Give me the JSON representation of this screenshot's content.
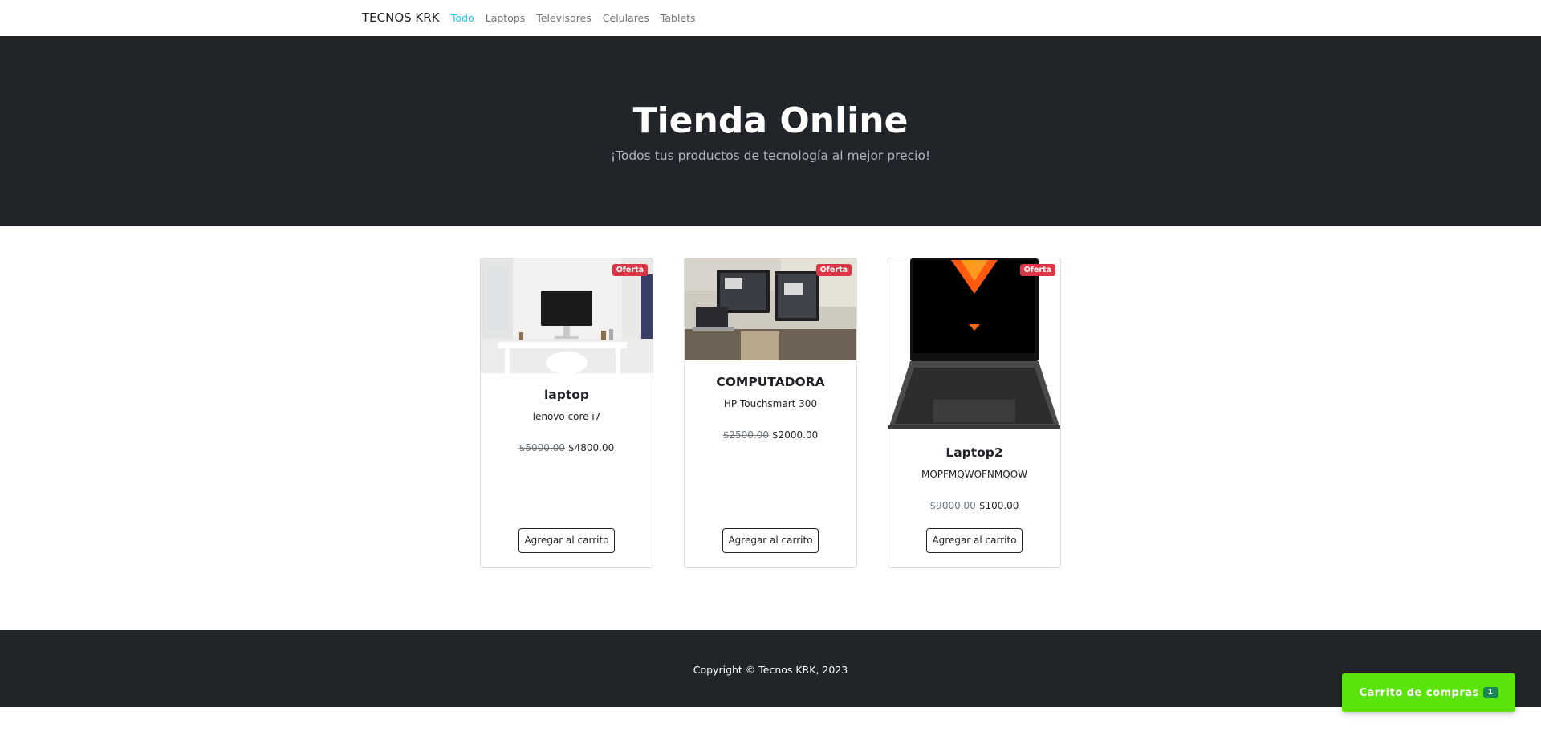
{
  "navbar": {
    "brand": "TECNOS KRK",
    "links": [
      {
        "label": "Todo",
        "active": true
      },
      {
        "label": "Laptops",
        "active": false
      },
      {
        "label": "Televisores",
        "active": false
      },
      {
        "label": "Celulares",
        "active": false
      },
      {
        "label": "Tablets",
        "active": false
      }
    ]
  },
  "hero": {
    "title": "Tienda Online",
    "subtitle": "¡Todos tus productos de tecnología al mejor precio!"
  },
  "products": [
    {
      "badge": "Oferta",
      "name": "laptop",
      "description": "lenovo core i7",
      "old_price": "$5000.00",
      "price": "$4800.00",
      "button": "Agregar al carrito",
      "image": "desk-with-imac-photo"
    },
    {
      "badge": "Oferta",
      "name": "COMPUTADORA",
      "description": "HP Touchsmart 300",
      "old_price": "$2500.00",
      "price": "$2000.00",
      "button": "Agregar al carrito",
      "image": "multi-monitor-desk-photo"
    },
    {
      "badge": "Oferta",
      "name": "Laptop2",
      "description": "MOPFMQWOFNMQOW",
      "old_price": "$9000.00",
      "price": "$100.00",
      "button": "Agregar al carrito",
      "image": "gaming-laptop-photo"
    }
  ],
  "footer": {
    "copyright": "Copyright © Tecnos KRK, 2023"
  },
  "cart": {
    "label": "Carrito de compras",
    "count": "1",
    "color": "#5be40c"
  },
  "colors": {
    "dark": "#212529",
    "active_link": "#0dcaf0",
    "badge": "#dc3545"
  }
}
